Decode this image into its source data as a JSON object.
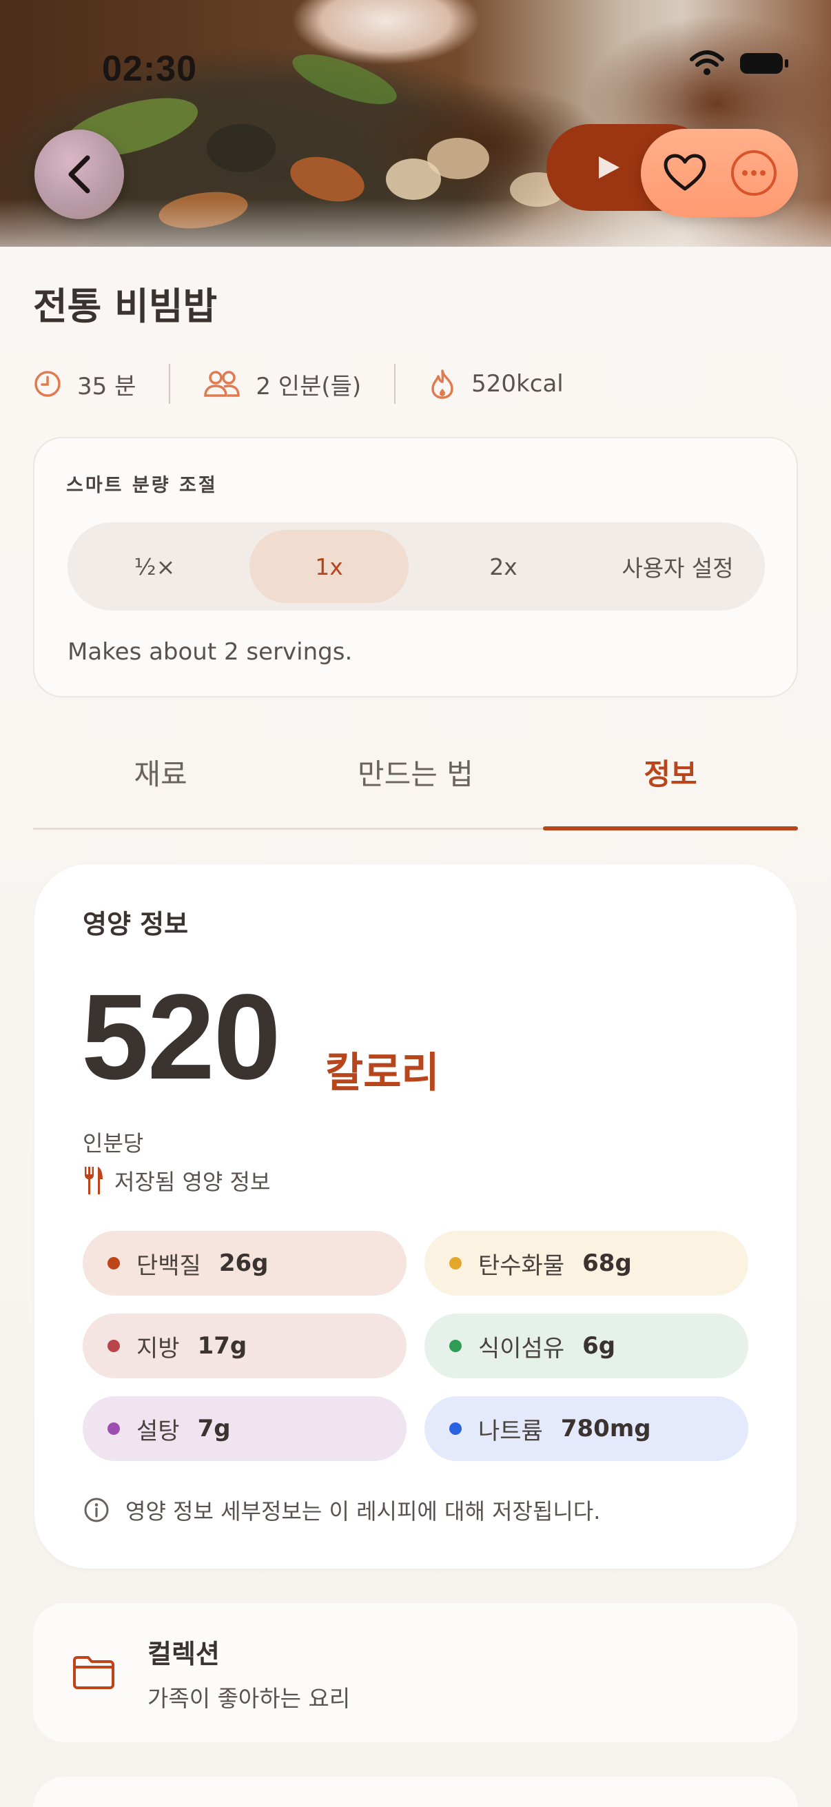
{
  "status": {
    "time": "02:30"
  },
  "header": {
    "back_icon": "chevron-left-icon",
    "play_icon": "play-icon",
    "favorite_icon": "heart-icon",
    "more_icon": "more-icon"
  },
  "recipe": {
    "title": "전통 비빔밥",
    "time": "35 분",
    "servings": "2 인분(들)",
    "calories": "520kcal"
  },
  "portion": {
    "title": "스마트 분량 조절",
    "options": [
      "½×",
      "1x",
      "2x",
      "사용자 설정"
    ],
    "selected": "1x",
    "note": "Makes about 2 servings."
  },
  "tabs": {
    "items": [
      "재료",
      "만드는 법",
      "정보"
    ],
    "active": "정보"
  },
  "nutrition": {
    "heading": "영양 정보",
    "calories": "520",
    "calories_unit": "칼로리",
    "per": "인분당",
    "saved": "저장됨 영양 정보",
    "items": [
      {
        "label": "단백질",
        "value": "26g",
        "dot": "#c0441a",
        "bg": "#f6e5df"
      },
      {
        "label": "탄수화물",
        "value": "68g",
        "dot": "#e2a82c",
        "bg": "#fcf2e2"
      },
      {
        "label": "지방",
        "value": "17g",
        "dot": "#b9454a",
        "bg": "#f4e5e3"
      },
      {
        "label": "식이섬유",
        "value": "6g",
        "dot": "#2f9c55",
        "bg": "#e6f2e9"
      },
      {
        "label": "설탕",
        "value": "7g",
        "dot": "#9c4fb0",
        "bg": "#f1e4f1"
      },
      {
        "label": "나트륨",
        "value": "780mg",
        "dot": "#2a63e0",
        "bg": "#e4eafb"
      }
    ],
    "note": "영양 정보 세부정보는 이 레시피에 대해 저장됩니다."
  },
  "collection": {
    "title": "컬렉션",
    "subtitle": "가족이 좋아하는 요리",
    "icon": "folder-icon"
  },
  "colors": {
    "accent": "#b8461d",
    "text": "#3a3330",
    "muted": "#5a524e"
  }
}
